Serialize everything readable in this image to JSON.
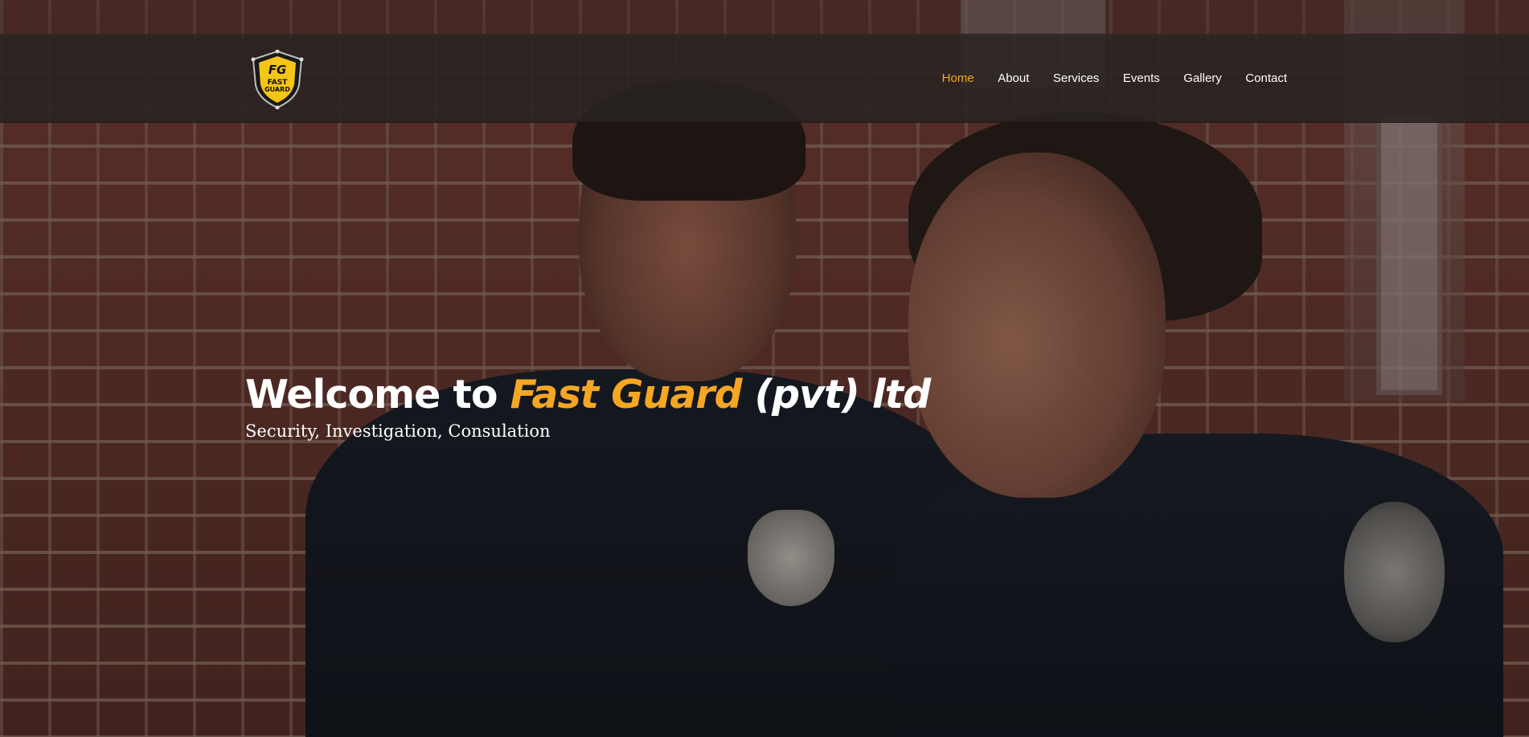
{
  "header": {
    "logo": {
      "icon": "shield-logo-icon",
      "monogram": "FG",
      "line1": "FAST",
      "line2": "GUARD",
      "shield_color": "#f5c518"
    },
    "nav": {
      "items": [
        {
          "label": "Home",
          "active": true
        },
        {
          "label": "About",
          "active": false
        },
        {
          "label": "Services",
          "active": false
        },
        {
          "label": "Events",
          "active": false
        },
        {
          "label": "Gallery",
          "active": false
        },
        {
          "label": "Contact",
          "active": false
        }
      ]
    }
  },
  "hero": {
    "title_prefix": "Welcome to ",
    "title_brand": "Fast Guard",
    "title_suffix": " (pvt) ltd",
    "subtitle": "Security, Investigation, Consulation",
    "background": "photo of two uniformed officers in front of brick wall"
  },
  "colors": {
    "accent": "#f5a623",
    "nav_bg": "#2b2423",
    "text": "#ffffff"
  }
}
